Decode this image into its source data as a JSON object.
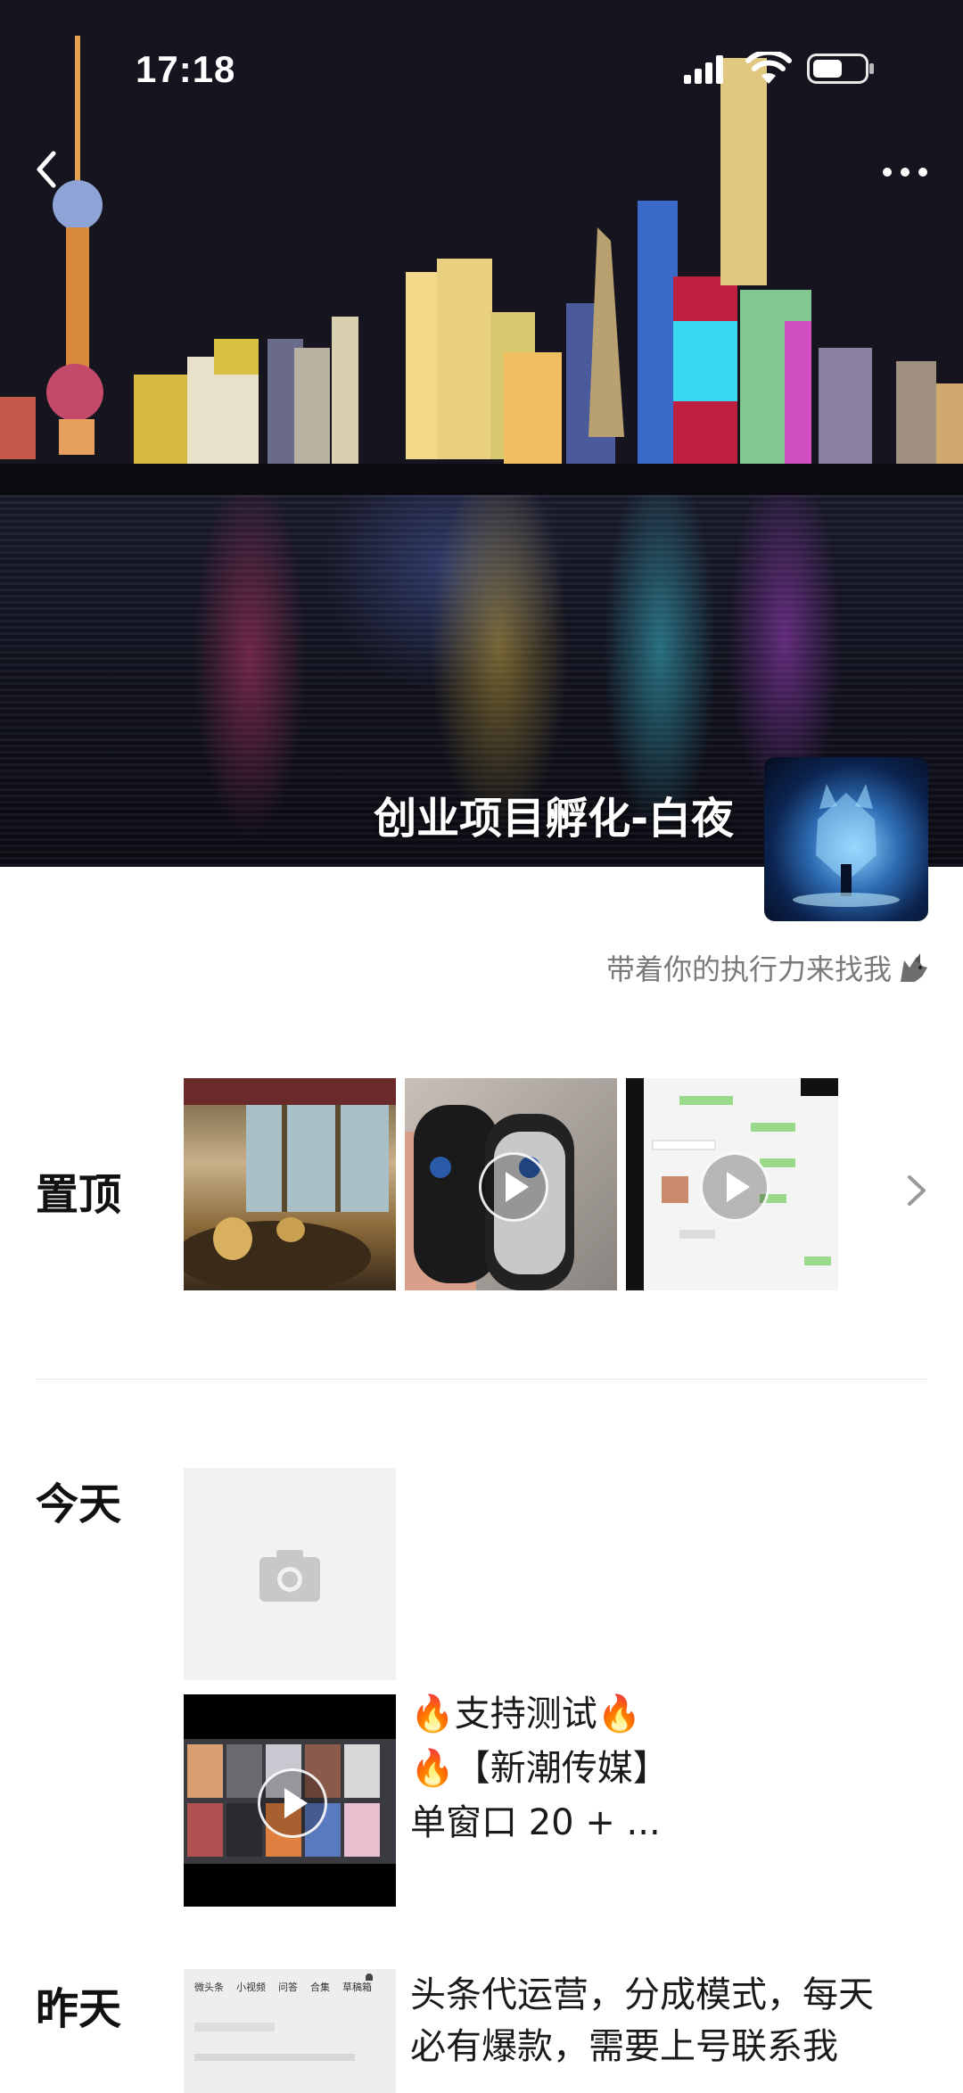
{
  "status_bar": {
    "time": "17:18"
  },
  "cover": {
    "description_icons": [
      "back-icon",
      "more-icon"
    ]
  },
  "profile": {
    "name": "创业项目孵化-白夜",
    "signature": "带着你的执行力来找我",
    "signature_icon": "wolf-emoji-icon"
  },
  "pinned": {
    "label": "置顶"
  },
  "today": {
    "label": "今天",
    "post_lines": [
      "🔥支持测试🔥",
      "🔥【新潮传媒】",
      "单窗口 20 + ..."
    ]
  },
  "yesterday": {
    "label": "昨天",
    "post_lines": [
      "头条代运营，分成模式，每天",
      "必有爆款，需要上号联系我"
    ],
    "thumb_tabs": [
      "微头条",
      "小视频",
      "问答",
      "合集",
      "草稿箱"
    ]
  },
  "colors": {
    "accent": "#ffffff",
    "signature_gray": "#7a7a7a"
  }
}
